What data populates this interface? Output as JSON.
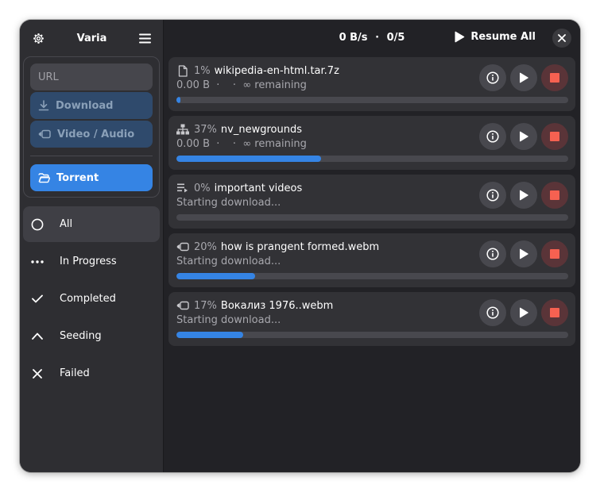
{
  "sidebar": {
    "title": "Varia",
    "url_placeholder": "URL",
    "download_label": "Download",
    "video_audio_label": "Video / Audio",
    "torrent_label": "Torrent",
    "filters": [
      {
        "label": "All",
        "icon": "circle-icon",
        "active": true
      },
      {
        "label": "In Progress",
        "icon": "dots-icon",
        "active": false
      },
      {
        "label": "Completed",
        "icon": "check-icon",
        "active": false
      },
      {
        "label": "Seeding",
        "icon": "chevron-up-icon",
        "active": false
      },
      {
        "label": "Failed",
        "icon": "x-icon",
        "active": false
      }
    ]
  },
  "header": {
    "speed": "0 B/s",
    "separator": "·",
    "count": "0/5",
    "resume_all_label": "Resume All"
  },
  "colors": {
    "accent": "#3584e4",
    "stop_icon": "#f66151"
  },
  "downloads": [
    {
      "icon": "file-icon",
      "percent_label": "1%",
      "name": "wikipedia-en-html.tar.7z",
      "status": "0.00 B  ·    ·  ∞ remaining",
      "progress": 0.01
    },
    {
      "icon": "network-icon",
      "percent_label": "37%",
      "name": "nv_newgrounds",
      "status": "0.00 B  ·    ·  ∞ remaining",
      "progress": 0.37
    },
    {
      "icon": "playlist-icon",
      "percent_label": "0%",
      "name": "important videos",
      "status": "Starting download...",
      "progress": 0.0
    },
    {
      "icon": "video-icon",
      "percent_label": "20%",
      "name": "how is prangent formed.webm",
      "status": "Starting download...",
      "progress": 0.2
    },
    {
      "icon": "video-icon",
      "percent_label": "17%",
      "name": "Вокализ 1976..webm",
      "status": "Starting download...",
      "progress": 0.17
    }
  ]
}
